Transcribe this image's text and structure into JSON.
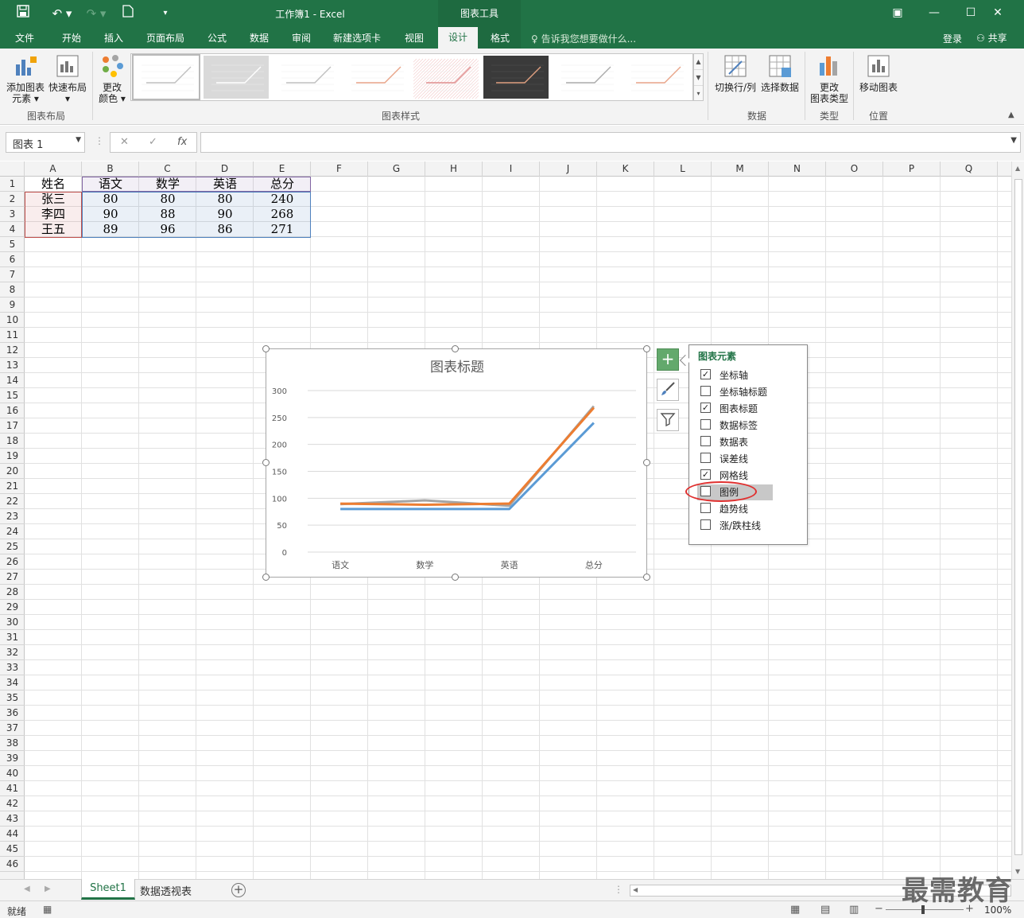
{
  "window": {
    "title": "工作簿1 - Excel",
    "context_tab": "图表工具",
    "login": "登录",
    "share": "共享"
  },
  "tabs": [
    "文件",
    "开始",
    "插入",
    "页面布局",
    "公式",
    "数据",
    "审阅",
    "新建选项卡",
    "视图",
    "设计",
    "格式"
  ],
  "tell_me": "告诉我您想要做什么...",
  "ribbon": {
    "add_element": "添加图表",
    "add_element_2": "元素",
    "quick_layout": "快速布局",
    "change_colors": "更改",
    "change_colors_2": "颜色",
    "switch_row_col": "切换行/列",
    "select_data": "选择数据",
    "change_type": "更改",
    "change_type_2": "图表类型",
    "move_chart": "移动图表",
    "groups": {
      "layout": "图表布局",
      "styles": "图表样式",
      "data": "数据",
      "type": "类型",
      "location": "位置"
    }
  },
  "formula_bar": {
    "name_box": "图表 1",
    "cancel": "✕",
    "enter": "✓",
    "fx": "fx",
    "value": ""
  },
  "columns": [
    "A",
    "B",
    "C",
    "D",
    "E",
    "F",
    "G",
    "H",
    "I",
    "J",
    "K",
    "L",
    "M",
    "N",
    "O",
    "P",
    "Q"
  ],
  "rows": [
    "1",
    "2",
    "3",
    "4",
    "5",
    "6",
    "7",
    "8",
    "9",
    "10",
    "11",
    "12",
    "13",
    "14",
    "15",
    "16",
    "17",
    "18",
    "19",
    "20",
    "21",
    "22",
    "23",
    "24",
    "25",
    "26",
    "27",
    "28",
    "29",
    "30",
    "31",
    "32",
    "33",
    "34",
    "35",
    "36",
    "37",
    "38",
    "39",
    "40",
    "41",
    "42",
    "43",
    "44",
    "45",
    "46"
  ],
  "table": {
    "header": [
      "姓名",
      "语文",
      "数学",
      "英语",
      "总分"
    ],
    "rows": [
      [
        "张三",
        "80",
        "80",
        "80",
        "240"
      ],
      [
        "李四",
        "90",
        "88",
        "90",
        "268"
      ],
      [
        "王五",
        "89",
        "96",
        "86",
        "271"
      ]
    ]
  },
  "chart_data": {
    "type": "line",
    "title": "图表标题",
    "categories": [
      "语文",
      "数学",
      "英语",
      "总分"
    ],
    "series": [
      {
        "values": [
          80,
          80,
          80,
          240
        ],
        "color": "#5b9bd5"
      },
      {
        "values": [
          90,
          88,
          90,
          268
        ],
        "color": "#ed7d31"
      },
      {
        "values": [
          89,
          96,
          86,
          271
        ],
        "color": "#a5a5a5"
      }
    ],
    "yticks": [
      "0",
      "50",
      "100",
      "150",
      "200",
      "250",
      "300"
    ],
    "ylim": [
      0,
      300
    ],
    "grid": true,
    "legend": "none"
  },
  "chart_elements_panel": {
    "title": "图表元素",
    "options": [
      {
        "label": "坐标轴",
        "checked": true
      },
      {
        "label": "坐标轴标题",
        "checked": false
      },
      {
        "label": "图表标题",
        "checked": true
      },
      {
        "label": "数据标签",
        "checked": false
      },
      {
        "label": "数据表",
        "checked": false
      },
      {
        "label": "误差线",
        "checked": false
      },
      {
        "label": "网格线",
        "checked": true
      },
      {
        "label": "图例",
        "checked": false
      },
      {
        "label": "趋势线",
        "checked": false
      },
      {
        "label": "涨/跌柱线",
        "checked": false
      }
    ]
  },
  "sheets": {
    "sheet1": "Sheet1",
    "pivot": "数据透视表"
  },
  "status": {
    "ready": "就绪",
    "zoom": "100%"
  },
  "watermark": "最需教育",
  "colors": {
    "accent": "#217346",
    "highlight": "#e0302f"
  }
}
